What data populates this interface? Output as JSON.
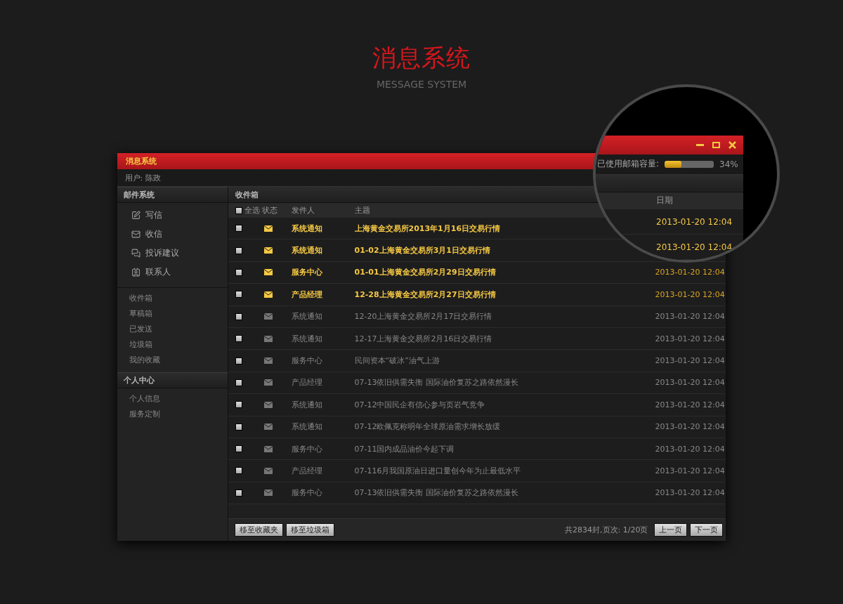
{
  "heading": {
    "title": "消息系统",
    "subtitle": "MESSAGE SYSTEM"
  },
  "window": {
    "title": "消息系统",
    "user": "用户: 陈政"
  },
  "sidebar": {
    "sections": [
      {
        "title": "邮件系统",
        "actions": [
          {
            "kind": "compose",
            "label": "写信"
          },
          {
            "kind": "inbox",
            "label": "收信"
          },
          {
            "kind": "feedback",
            "label": "投诉建议"
          },
          {
            "kind": "contacts",
            "label": "联系人"
          }
        ],
        "items": [
          "收件箱",
          "草稿箱",
          "已发送",
          "垃圾箱",
          "我的收藏"
        ]
      },
      {
        "title": "个人中心",
        "items": [
          "个人信息",
          "服务定制"
        ]
      }
    ]
  },
  "inbox": {
    "title": "收件箱",
    "select_all": {
      "label": "全选",
      "checked": false
    },
    "columns": [
      "状态",
      "发件人",
      "主题"
    ],
    "rows": [
      {
        "checked": false,
        "unread": true,
        "sender": "系统通知",
        "subject": "上海黄金交易所2013年1月16日交易行情"
      },
      {
        "checked": false,
        "unread": true,
        "sender": "系统通知",
        "subject": "01-02上海黄金交易所3月1日交易行情"
      },
      {
        "checked": false,
        "unread": true,
        "sender": "服务中心",
        "subject": "01-01上海黄金交易所2月29日交易行情",
        "date": "2013-01-20 12:04"
      },
      {
        "checked": false,
        "unread": true,
        "sender": "产品经理",
        "subject": "12-28上海黄金交易所2月27日交易行情",
        "date": "2013-01-20 12:04"
      },
      {
        "checked": false,
        "unread": false,
        "sender": "系统通知",
        "subject": "12-20上海黄金交易所2月17日交易行情",
        "date": "2013-01-20 12:04"
      },
      {
        "checked": false,
        "unread": false,
        "sender": "系统通知",
        "subject": "12-17上海黄金交易所2月16日交易行情",
        "date": "2013-01-20 12:04"
      },
      {
        "checked": false,
        "unread": false,
        "sender": "服务中心",
        "subject": "民间资本“破冰”油气上游",
        "date": "2013-01-20 12:04"
      },
      {
        "checked": false,
        "unread": false,
        "sender": "产品经理",
        "subject": "07-13依旧供需失衡 国际油价复苏之路依然漫长",
        "date": "2013-01-20 12:04"
      },
      {
        "checked": false,
        "unread": false,
        "sender": "系统通知",
        "subject": "07-12中国民企有信心参与页岩气竞争",
        "date": "2013-01-20 12:04"
      },
      {
        "checked": false,
        "unread": false,
        "sender": "系统通知",
        "subject": "07-12欧佩克称明年全球原油需求增长放缓",
        "date": "2013-01-20 12:04"
      },
      {
        "checked": false,
        "unread": false,
        "sender": "服务中心",
        "subject": "07-11国内成品油价今起下调",
        "date": "2013-01-20 12:04"
      },
      {
        "checked": false,
        "unread": false,
        "sender": "产品经理",
        "subject": "07-116月我国原油日进口量创今年为止最低水平",
        "date": "2013-01-20 12:04"
      },
      {
        "checked": false,
        "unread": false,
        "sender": "服务中心",
        "subject": "07-13依旧供需失衡 国际油价复苏之路依然漫长",
        "date": "2013-01-20 12:04"
      }
    ],
    "actions": [
      "移至收藏夹",
      "移至垃圾箱"
    ],
    "pagination": {
      "summary": "共2834封,页次: 1/20页",
      "prev": "上一页",
      "next": "下一页"
    }
  },
  "magnifier": {
    "capacity": {
      "label": "已使用邮箱容量:",
      "level": 0.34,
      "reading": "34%"
    },
    "date_column": "日期",
    "dates": [
      "2013-01-20 12:04",
      "2013-01-20 12:04"
    ]
  }
}
